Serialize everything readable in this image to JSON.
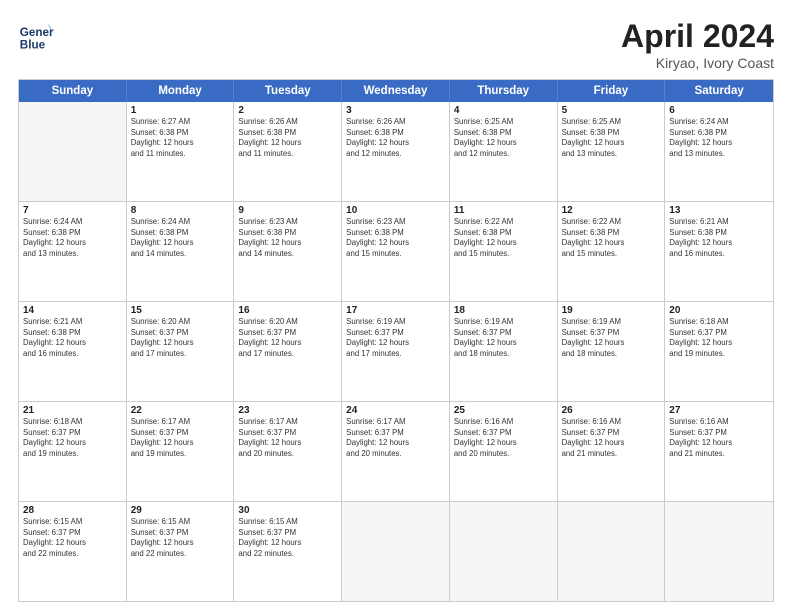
{
  "header": {
    "logo_line1": "General",
    "logo_line2": "Blue",
    "title": "April 2024",
    "location": "Kiryao, Ivory Coast"
  },
  "days_of_week": [
    "Sunday",
    "Monday",
    "Tuesday",
    "Wednesday",
    "Thursday",
    "Friday",
    "Saturday"
  ],
  "rows": [
    [
      {
        "num": "",
        "info": ""
      },
      {
        "num": "1",
        "info": "Sunrise: 6:27 AM\nSunset: 6:38 PM\nDaylight: 12 hours\nand 11 minutes."
      },
      {
        "num": "2",
        "info": "Sunrise: 6:26 AM\nSunset: 6:38 PM\nDaylight: 12 hours\nand 11 minutes."
      },
      {
        "num": "3",
        "info": "Sunrise: 6:26 AM\nSunset: 6:38 PM\nDaylight: 12 hours\nand 12 minutes."
      },
      {
        "num": "4",
        "info": "Sunrise: 6:25 AM\nSunset: 6:38 PM\nDaylight: 12 hours\nand 12 minutes."
      },
      {
        "num": "5",
        "info": "Sunrise: 6:25 AM\nSunset: 6:38 PM\nDaylight: 12 hours\nand 13 minutes."
      },
      {
        "num": "6",
        "info": "Sunrise: 6:24 AM\nSunset: 6:38 PM\nDaylight: 12 hours\nand 13 minutes."
      }
    ],
    [
      {
        "num": "7",
        "info": "Sunrise: 6:24 AM\nSunset: 6:38 PM\nDaylight: 12 hours\nand 13 minutes."
      },
      {
        "num": "8",
        "info": "Sunrise: 6:24 AM\nSunset: 6:38 PM\nDaylight: 12 hours\nand 14 minutes."
      },
      {
        "num": "9",
        "info": "Sunrise: 6:23 AM\nSunset: 6:38 PM\nDaylight: 12 hours\nand 14 minutes."
      },
      {
        "num": "10",
        "info": "Sunrise: 6:23 AM\nSunset: 6:38 PM\nDaylight: 12 hours\nand 15 minutes."
      },
      {
        "num": "11",
        "info": "Sunrise: 6:22 AM\nSunset: 6:38 PM\nDaylight: 12 hours\nand 15 minutes."
      },
      {
        "num": "12",
        "info": "Sunrise: 6:22 AM\nSunset: 6:38 PM\nDaylight: 12 hours\nand 15 minutes."
      },
      {
        "num": "13",
        "info": "Sunrise: 6:21 AM\nSunset: 6:38 PM\nDaylight: 12 hours\nand 16 minutes."
      }
    ],
    [
      {
        "num": "14",
        "info": "Sunrise: 6:21 AM\nSunset: 6:38 PM\nDaylight: 12 hours\nand 16 minutes."
      },
      {
        "num": "15",
        "info": "Sunrise: 6:20 AM\nSunset: 6:37 PM\nDaylight: 12 hours\nand 17 minutes."
      },
      {
        "num": "16",
        "info": "Sunrise: 6:20 AM\nSunset: 6:37 PM\nDaylight: 12 hours\nand 17 minutes."
      },
      {
        "num": "17",
        "info": "Sunrise: 6:19 AM\nSunset: 6:37 PM\nDaylight: 12 hours\nand 17 minutes."
      },
      {
        "num": "18",
        "info": "Sunrise: 6:19 AM\nSunset: 6:37 PM\nDaylight: 12 hours\nand 18 minutes."
      },
      {
        "num": "19",
        "info": "Sunrise: 6:19 AM\nSunset: 6:37 PM\nDaylight: 12 hours\nand 18 minutes."
      },
      {
        "num": "20",
        "info": "Sunrise: 6:18 AM\nSunset: 6:37 PM\nDaylight: 12 hours\nand 19 minutes."
      }
    ],
    [
      {
        "num": "21",
        "info": "Sunrise: 6:18 AM\nSunset: 6:37 PM\nDaylight: 12 hours\nand 19 minutes."
      },
      {
        "num": "22",
        "info": "Sunrise: 6:17 AM\nSunset: 6:37 PM\nDaylight: 12 hours\nand 19 minutes."
      },
      {
        "num": "23",
        "info": "Sunrise: 6:17 AM\nSunset: 6:37 PM\nDaylight: 12 hours\nand 20 minutes."
      },
      {
        "num": "24",
        "info": "Sunrise: 6:17 AM\nSunset: 6:37 PM\nDaylight: 12 hours\nand 20 minutes."
      },
      {
        "num": "25",
        "info": "Sunrise: 6:16 AM\nSunset: 6:37 PM\nDaylight: 12 hours\nand 20 minutes."
      },
      {
        "num": "26",
        "info": "Sunrise: 6:16 AM\nSunset: 6:37 PM\nDaylight: 12 hours\nand 21 minutes."
      },
      {
        "num": "27",
        "info": "Sunrise: 6:16 AM\nSunset: 6:37 PM\nDaylight: 12 hours\nand 21 minutes."
      }
    ],
    [
      {
        "num": "28",
        "info": "Sunrise: 6:15 AM\nSunset: 6:37 PM\nDaylight: 12 hours\nand 22 minutes."
      },
      {
        "num": "29",
        "info": "Sunrise: 6:15 AM\nSunset: 6:37 PM\nDaylight: 12 hours\nand 22 minutes."
      },
      {
        "num": "30",
        "info": "Sunrise: 6:15 AM\nSunset: 6:37 PM\nDaylight: 12 hours\nand 22 minutes."
      },
      {
        "num": "",
        "info": ""
      },
      {
        "num": "",
        "info": ""
      },
      {
        "num": "",
        "info": ""
      },
      {
        "num": "",
        "info": ""
      }
    ]
  ]
}
